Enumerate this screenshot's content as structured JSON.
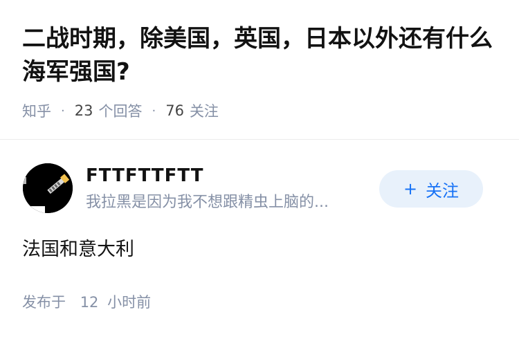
{
  "question": {
    "title": "二战时期，除美国，英国，日本以外还有什么海军强国?",
    "source": "知乎",
    "answer_count": "23",
    "answer_label": "个回答",
    "follow_count": "76",
    "follow_label": "关注"
  },
  "answer": {
    "author": {
      "name": "FTTFTTFTT",
      "bio": "我拉黑是因为我不想跟精虫上脑的..."
    },
    "follow_button": {
      "icon": "plus-icon",
      "label": "关注"
    },
    "content": "法国和意大利",
    "published": {
      "prefix": "发布于",
      "value": "12",
      "unit": "小时前"
    }
  },
  "colors": {
    "title": "#121212",
    "meta": "#8590a6",
    "accent": "#1772f6",
    "follow_bg": "#e8f1fb"
  }
}
